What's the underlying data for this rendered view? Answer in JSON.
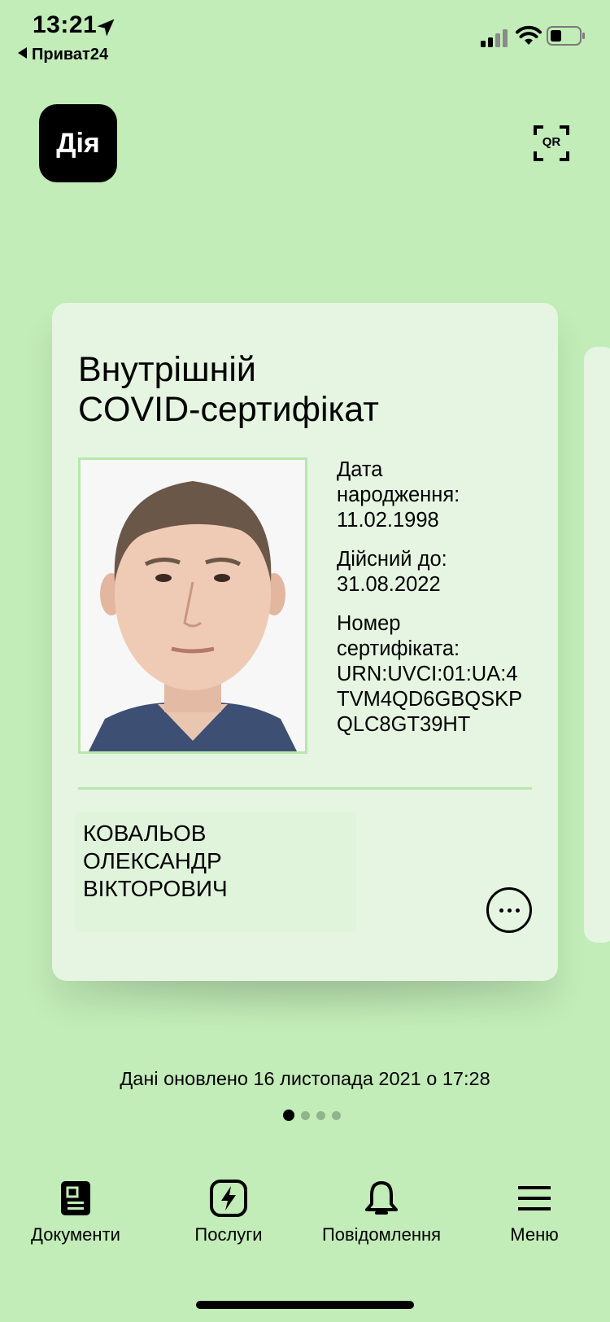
{
  "status_bar": {
    "time": "13:21",
    "back_app": "Приват24"
  },
  "header": {
    "logo_text": "Дія",
    "qr_label": "QR"
  },
  "card": {
    "title_line1": "Внутрішній",
    "title_line2": "COVID-сертифікат",
    "birth_label_1": "Дата",
    "birth_label_2": "народження:",
    "birth_date": "11.02.1998",
    "valid_label": "Дійсний до:",
    "valid_date": "31.08.2022",
    "cert_label_1": "Номер",
    "cert_label_2": "сертифіката:",
    "cert_number_1": "URN:UVCI:01:UA:4",
    "cert_number_2": "TVM4QD6GBQSKP",
    "cert_number_3": "QLC8GT39HT",
    "surname": "КОВАЛЬОВ",
    "first_name": "ОЛЕКСАНДР",
    "patronymic": "ВІКТОРОВИЧ"
  },
  "updated_text": "Дані оновлено 16 листопада 2021 о 17:28",
  "pagination": {
    "total": 4,
    "active": 1
  },
  "nav": {
    "documents": "Документи",
    "services": "Послуги",
    "notifications": "Повідомлення",
    "menu": "Меню"
  },
  "colors": {
    "background": "#c2ecb8",
    "card": "#e5f5e1",
    "accent_border": "#b7e7ac"
  },
  "icons": [
    "location-arrow-icon",
    "signal-icon",
    "wifi-icon",
    "battery-icon",
    "qr-scan-icon",
    "more-icon",
    "documents-icon",
    "services-icon",
    "bell-icon",
    "menu-icon"
  ]
}
